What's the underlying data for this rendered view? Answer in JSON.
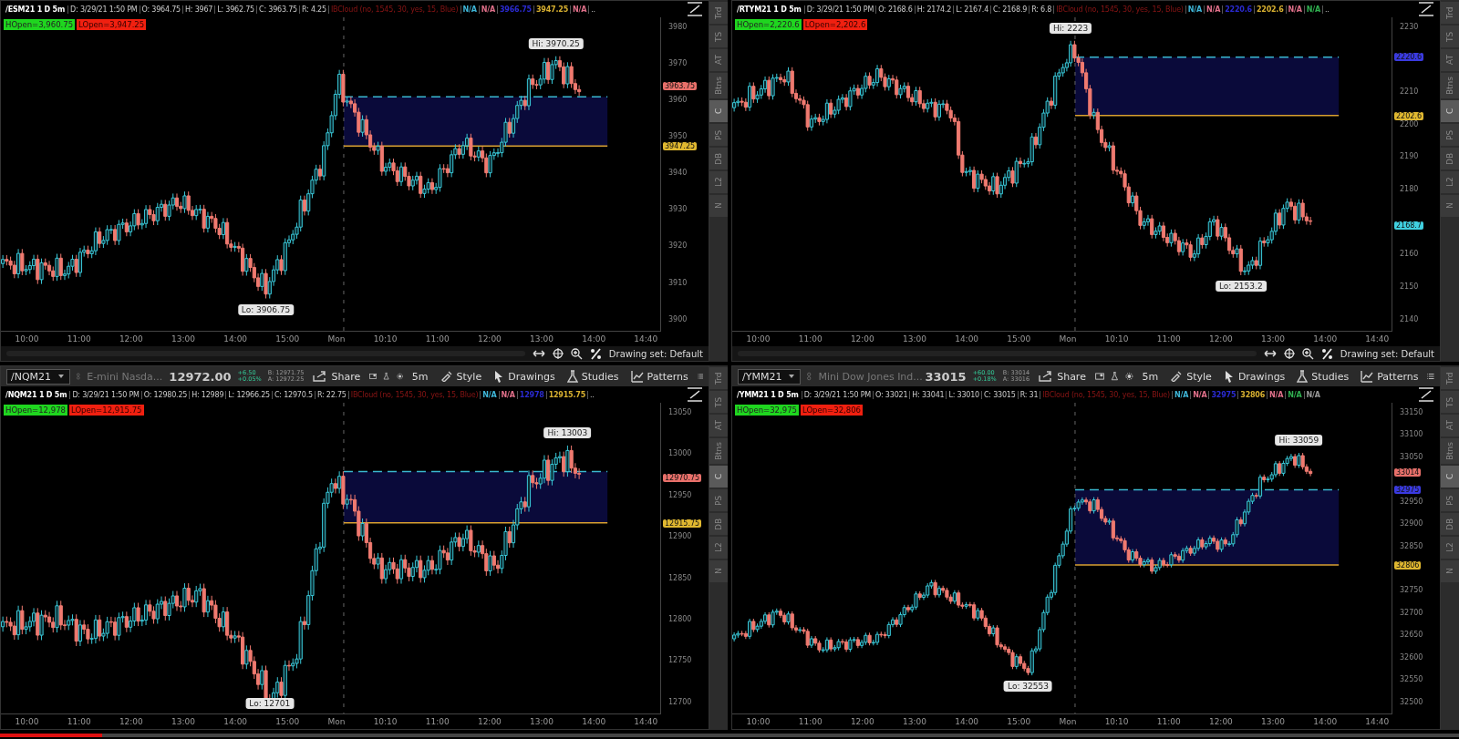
{
  "panes": [
    {
      "header": {
        "symbol": "/ESM21 1 D 5m",
        "fields": [
          "D: 3/29/21 1:50 PM",
          "O: 3964.75",
          "H: 3967",
          "L: 3962.75",
          "C: 3963.75",
          "R: 4.25"
        ],
        "study": "IBCloud (no, 1545, 30, yes, 15, Blue)",
        "chips": [
          {
            "text": "N/A",
            "color": "#3fb6d8"
          },
          {
            "text": "N/A",
            "color": "#e0708a"
          },
          {
            "text": "3966.75",
            "color": "#2a2ad0"
          },
          {
            "text": "3947.25",
            "color": "#d8b030"
          },
          {
            "text": "N/A",
            "color": "#e0708a"
          }
        ],
        "more": ".."
      },
      "hopen": "HOpen=3,960.75",
      "lopen": "LOpen=3,947.25",
      "yticks": [
        "3980",
        "3970",
        "3960",
        "3950",
        "3940",
        "3930",
        "3920",
        "3910",
        "3900"
      ],
      "price_tags": [
        {
          "text": "3963.75",
          "color": "#e8706a"
        },
        {
          "text": "3947.25",
          "color": "#e0b830"
        }
      ],
      "hi": "Hi: 3970.25",
      "lo": "Lo: 3906.75",
      "xticks": [
        "10:00",
        "11:00",
        "12:00",
        "13:00",
        "14:00",
        "15:00",
        "Mon",
        "10:10",
        "11:00",
        "12:00",
        "13:00",
        "14:00",
        "14:40"
      ],
      "footer": "Drawing set: Default",
      "side_tabs": [
        {
          "label": "Trd",
          "selected": false
        },
        {
          "label": "TS",
          "selected": false
        },
        {
          "label": "AT",
          "selected": false
        },
        {
          "label": "Btns",
          "selected": false
        },
        {
          "label": "C",
          "selected": true
        },
        {
          "label": "PS",
          "selected": false
        },
        {
          "label": "DB",
          "selected": false
        },
        {
          "label": "L2",
          "selected": false
        },
        {
          "label": "N",
          "selected": false
        }
      ]
    },
    {
      "header": {
        "symbol": "/RTYM21 1 D 5m",
        "fields": [
          "D: 3/29/21 1:50 PM",
          "O: 2168.6",
          "H: 2174.2",
          "L: 2167.4",
          "C: 2168.9",
          "R: 6.8"
        ],
        "study": "IBCloud (no, 1545, 30, yes, 15, Blue)",
        "chips": [
          {
            "text": "N/A",
            "color": "#3fb6d8"
          },
          {
            "text": "N/A",
            "color": "#e0708a"
          },
          {
            "text": "2220.6",
            "color": "#2a2ad0"
          },
          {
            "text": "2202.6",
            "color": "#d8b030"
          },
          {
            "text": "N/A",
            "color": "#e0708a"
          },
          {
            "text": "N/A",
            "color": "#30b050"
          }
        ],
        "more": ".."
      },
      "hopen": "HOpen=2,220.6",
      "lopen": "LOpen=2,202.6",
      "yticks": [
        "2230",
        "2210",
        "2200",
        "2190",
        "2180",
        "2160",
        "2150",
        "2140"
      ],
      "price_tags": [
        {
          "text": "2220.6",
          "color": "#3a3ae0"
        },
        {
          "text": "2202.6",
          "color": "#e0b830"
        },
        {
          "text": "2168.7",
          "color": "#40d0e0"
        }
      ],
      "hi": "Hi: 2223",
      "lo": "Lo: 2153.2",
      "xticks": [
        "10:00",
        "11:00",
        "12:00",
        "13:00",
        "14:00",
        "15:00",
        "Mon",
        "10:10",
        "11:00",
        "12:00",
        "13:00",
        "14:00",
        "14:40"
      ],
      "footer": "Drawing set: Default",
      "side_tabs": [
        {
          "label": "Trd",
          "selected": false
        },
        {
          "label": "TS",
          "selected": false
        },
        {
          "label": "AT",
          "selected": false
        },
        {
          "label": "Btns",
          "selected": false
        },
        {
          "label": "C",
          "selected": true
        },
        {
          "label": "PS",
          "selected": false
        },
        {
          "label": "DB",
          "selected": false
        },
        {
          "label": "L2",
          "selected": false
        },
        {
          "label": "N",
          "selected": false
        }
      ]
    },
    {
      "toolbar": {
        "symbol": "/NQM21",
        "description": "E-mini Nasda...",
        "price": "12972.00",
        "change": "+6.50",
        "change_pct": "+0.05%",
        "bid": "B: 12971.75",
        "ask": "A: 12972.25",
        "buttons": [
          "Share",
          "5m",
          "Style",
          "Drawings",
          "Studies",
          "Patterns"
        ]
      },
      "header": {
        "symbol": "/NQM21 1 D 5m",
        "fields": [
          "D: 3/29/21 1:50 PM",
          "O: 12980.25",
          "H: 12989",
          "L: 12966.25",
          "C: 12970.5",
          "R: 22.75"
        ],
        "study": "IBCloud (no, 1545, 30, yes, 15, Blue)",
        "chips": [
          {
            "text": "N/A",
            "color": "#3fb6d8"
          },
          {
            "text": "N/A",
            "color": "#e0708a"
          },
          {
            "text": "12978",
            "color": "#2a2ad0"
          },
          {
            "text": "12915.75",
            "color": "#d8b030"
          }
        ],
        "more": ".."
      },
      "hopen": "HOpen=12,978",
      "lopen": "LOpen=12,915.75",
      "yticks": [
        "13050",
        "13000",
        "12950",
        "12900",
        "12850",
        "12800",
        "12750",
        "12700"
      ],
      "price_tags": [
        {
          "text": "12970.75",
          "color": "#e8706a"
        },
        {
          "text": "12915.75",
          "color": "#e0b830"
        }
      ],
      "hi": "Hi: 13003",
      "lo": "Lo: 12701",
      "xticks": [
        "10:00",
        "11:00",
        "12:00",
        "13:00",
        "14:00",
        "15:00",
        "Mon",
        "10:10",
        "11:00",
        "12:00",
        "13:00",
        "14:00",
        "14:40"
      ],
      "side_tabs": [
        {
          "label": "Trd",
          "selected": false
        },
        {
          "label": "TS",
          "selected": false
        },
        {
          "label": "AT",
          "selected": false
        },
        {
          "label": "Btns",
          "selected": false
        },
        {
          "label": "C",
          "selected": true
        },
        {
          "label": "PS",
          "selected": false
        },
        {
          "label": "DB",
          "selected": false
        },
        {
          "label": "L2",
          "selected": false
        },
        {
          "label": "N",
          "selected": false
        }
      ]
    },
    {
      "toolbar": {
        "symbol": "/YMM21",
        "description": "Mini Dow Jones Ind...",
        "price": "33015",
        "change": "+60.00",
        "change_pct": "+0.18%",
        "bid": "B: 33014",
        "ask": "A: 33016",
        "buttons": [
          "Share",
          "5m",
          "Style",
          "Drawings",
          "Studies",
          "Patterns"
        ]
      },
      "header": {
        "symbol": "/YMM21 1 D 5m",
        "fields": [
          "D: 3/29/21 1:50 PM",
          "O: 33021",
          "H: 33041",
          "L: 33010",
          "C: 33015",
          "R: 31"
        ],
        "study": "IBCloud (no, 1545, 30, yes, 15, Blue)",
        "chips": [
          {
            "text": "N/A",
            "color": "#3fb6d8"
          },
          {
            "text": "N/A",
            "color": "#e0708a"
          },
          {
            "text": "32975",
            "color": "#2a2ad0"
          },
          {
            "text": "32806",
            "color": "#d8b030"
          },
          {
            "text": "N/A",
            "color": "#e0708a"
          },
          {
            "text": "N/A",
            "color": "#30b050"
          },
          {
            "text": "N/A",
            "color": "#9a9a9a"
          }
        ]
      },
      "hopen": "HOpen=32,975",
      "lopen": "LOpen=32,806",
      "yticks": [
        "33150",
        "33100",
        "33050",
        "32950",
        "32900",
        "32850",
        "32750",
        "32700",
        "32650",
        "32600",
        "32550",
        "32500"
      ],
      "price_tags": [
        {
          "text": "33014",
          "color": "#e8706a"
        },
        {
          "text": "32975",
          "color": "#3a3ae0"
        },
        {
          "text": "32806",
          "color": "#e0b830"
        }
      ],
      "hi": "Hi: 33059",
      "lo": "Lo: 32553",
      "xticks": [
        "10:00",
        "11:00",
        "12:00",
        "13:00",
        "14:00",
        "15:00",
        "Mon",
        "10:10",
        "11:00",
        "12:00",
        "13:00",
        "14:00",
        "14:40"
      ],
      "side_tabs": [
        {
          "label": "Trd",
          "selected": false
        },
        {
          "label": "TS",
          "selected": false
        },
        {
          "label": "AT",
          "selected": false
        },
        {
          "label": "Btns",
          "selected": false
        },
        {
          "label": "C",
          "selected": true
        },
        {
          "label": "PS",
          "selected": false
        },
        {
          "label": "DB",
          "selected": false
        },
        {
          "label": "L2",
          "selected": false
        },
        {
          "label": "N",
          "selected": false
        }
      ]
    }
  ],
  "video_progress": {
    "level": 0.07
  }
}
